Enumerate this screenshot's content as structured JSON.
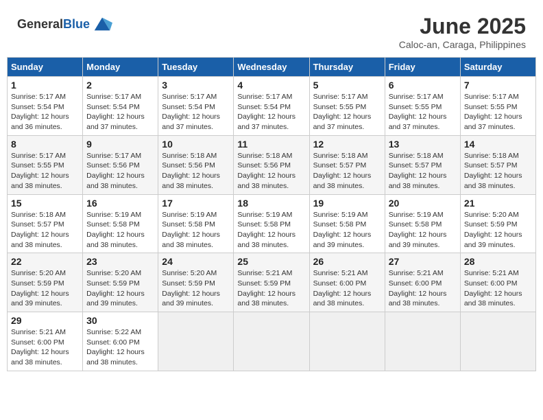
{
  "app": {
    "name": "GeneralBlue"
  },
  "header": {
    "title": "June 2025",
    "location": "Caloc-an, Caraga, Philippines"
  },
  "weekdays": [
    "Sunday",
    "Monday",
    "Tuesday",
    "Wednesday",
    "Thursday",
    "Friday",
    "Saturday"
  ],
  "weeks": [
    [
      {
        "day": "1",
        "sunrise": "5:17 AM",
        "sunset": "5:54 PM",
        "daylight": "12 hours and 36 minutes."
      },
      {
        "day": "2",
        "sunrise": "5:17 AM",
        "sunset": "5:54 PM",
        "daylight": "12 hours and 37 minutes."
      },
      {
        "day": "3",
        "sunrise": "5:17 AM",
        "sunset": "5:54 PM",
        "daylight": "12 hours and 37 minutes."
      },
      {
        "day": "4",
        "sunrise": "5:17 AM",
        "sunset": "5:54 PM",
        "daylight": "12 hours and 37 minutes."
      },
      {
        "day": "5",
        "sunrise": "5:17 AM",
        "sunset": "5:55 PM",
        "daylight": "12 hours and 37 minutes."
      },
      {
        "day": "6",
        "sunrise": "5:17 AM",
        "sunset": "5:55 PM",
        "daylight": "12 hours and 37 minutes."
      },
      {
        "day": "7",
        "sunrise": "5:17 AM",
        "sunset": "5:55 PM",
        "daylight": "12 hours and 37 minutes."
      }
    ],
    [
      {
        "day": "8",
        "sunrise": "5:17 AM",
        "sunset": "5:55 PM",
        "daylight": "12 hours and 38 minutes."
      },
      {
        "day": "9",
        "sunrise": "5:17 AM",
        "sunset": "5:56 PM",
        "daylight": "12 hours and 38 minutes."
      },
      {
        "day": "10",
        "sunrise": "5:18 AM",
        "sunset": "5:56 PM",
        "daylight": "12 hours and 38 minutes."
      },
      {
        "day": "11",
        "sunrise": "5:18 AM",
        "sunset": "5:56 PM",
        "daylight": "12 hours and 38 minutes."
      },
      {
        "day": "12",
        "sunrise": "5:18 AM",
        "sunset": "5:57 PM",
        "daylight": "12 hours and 38 minutes."
      },
      {
        "day": "13",
        "sunrise": "5:18 AM",
        "sunset": "5:57 PM",
        "daylight": "12 hours and 38 minutes."
      },
      {
        "day": "14",
        "sunrise": "5:18 AM",
        "sunset": "5:57 PM",
        "daylight": "12 hours and 38 minutes."
      }
    ],
    [
      {
        "day": "15",
        "sunrise": "5:18 AM",
        "sunset": "5:57 PM",
        "daylight": "12 hours and 38 minutes."
      },
      {
        "day": "16",
        "sunrise": "5:19 AM",
        "sunset": "5:58 PM",
        "daylight": "12 hours and 38 minutes."
      },
      {
        "day": "17",
        "sunrise": "5:19 AM",
        "sunset": "5:58 PM",
        "daylight": "12 hours and 38 minutes."
      },
      {
        "day": "18",
        "sunrise": "5:19 AM",
        "sunset": "5:58 PM",
        "daylight": "12 hours and 38 minutes."
      },
      {
        "day": "19",
        "sunrise": "5:19 AM",
        "sunset": "5:58 PM",
        "daylight": "12 hours and 39 minutes."
      },
      {
        "day": "20",
        "sunrise": "5:19 AM",
        "sunset": "5:58 PM",
        "daylight": "12 hours and 39 minutes."
      },
      {
        "day": "21",
        "sunrise": "5:20 AM",
        "sunset": "5:59 PM",
        "daylight": "12 hours and 39 minutes."
      }
    ],
    [
      {
        "day": "22",
        "sunrise": "5:20 AM",
        "sunset": "5:59 PM",
        "daylight": "12 hours and 39 minutes."
      },
      {
        "day": "23",
        "sunrise": "5:20 AM",
        "sunset": "5:59 PM",
        "daylight": "12 hours and 39 minutes."
      },
      {
        "day": "24",
        "sunrise": "5:20 AM",
        "sunset": "5:59 PM",
        "daylight": "12 hours and 39 minutes."
      },
      {
        "day": "25",
        "sunrise": "5:21 AM",
        "sunset": "5:59 PM",
        "daylight": "12 hours and 38 minutes."
      },
      {
        "day": "26",
        "sunrise": "5:21 AM",
        "sunset": "6:00 PM",
        "daylight": "12 hours and 38 minutes."
      },
      {
        "day": "27",
        "sunrise": "5:21 AM",
        "sunset": "6:00 PM",
        "daylight": "12 hours and 38 minutes."
      },
      {
        "day": "28",
        "sunrise": "5:21 AM",
        "sunset": "6:00 PM",
        "daylight": "12 hours and 38 minutes."
      }
    ],
    [
      {
        "day": "29",
        "sunrise": "5:21 AM",
        "sunset": "6:00 PM",
        "daylight": "12 hours and 38 minutes."
      },
      {
        "day": "30",
        "sunrise": "5:22 AM",
        "sunset": "6:00 PM",
        "daylight": "12 hours and 38 minutes."
      },
      null,
      null,
      null,
      null,
      null
    ]
  ],
  "labels": {
    "sunrise": "Sunrise:",
    "sunset": "Sunset:",
    "daylight": "Daylight:"
  }
}
